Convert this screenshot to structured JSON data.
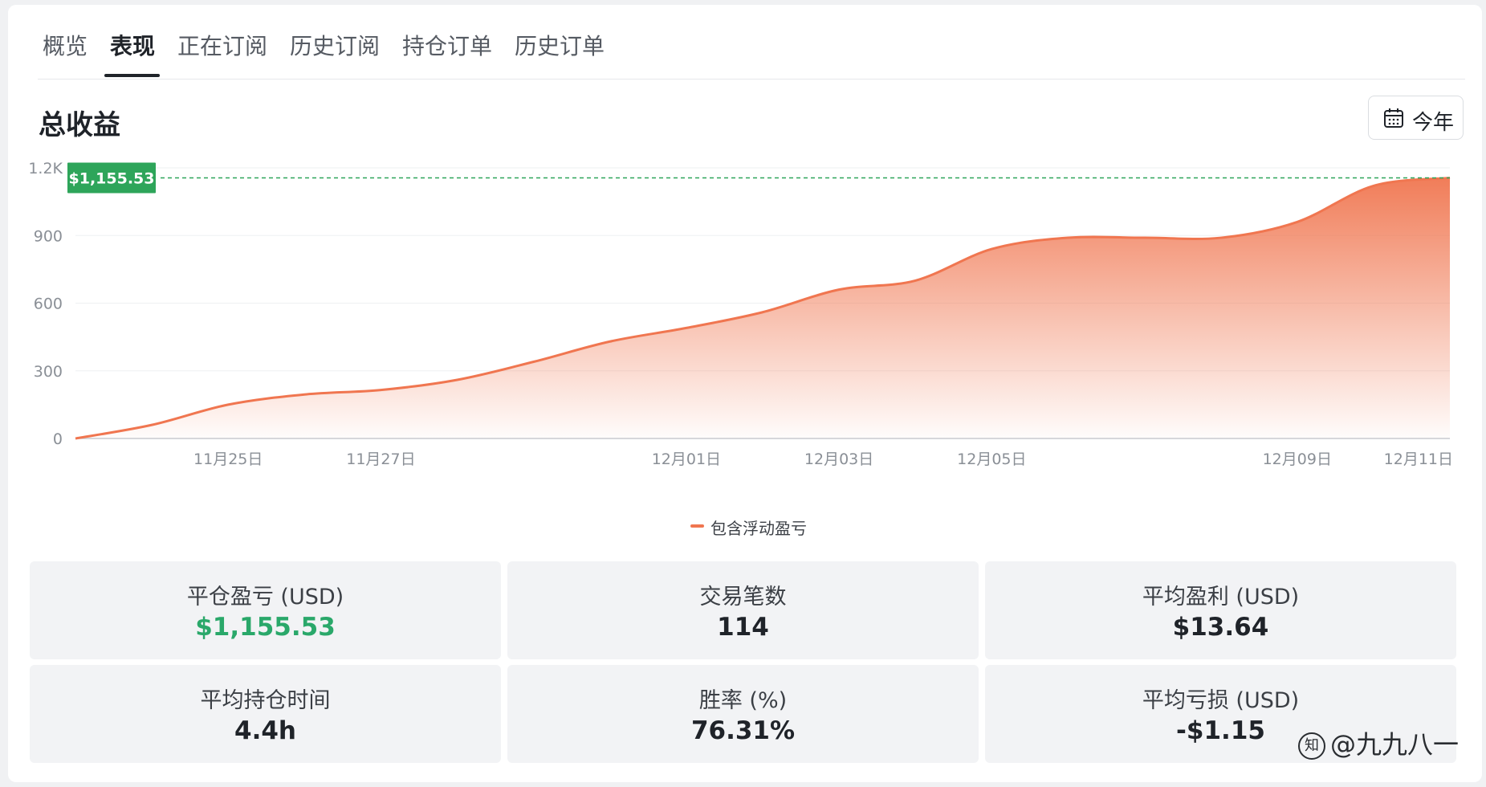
{
  "tabs": [
    {
      "label": "概览"
    },
    {
      "label": "表现"
    },
    {
      "label": "正在订阅"
    },
    {
      "label": "历史订阅"
    },
    {
      "label": "持仓订单"
    },
    {
      "label": "历史订单"
    }
  ],
  "active_tab": "表现",
  "section_title": "总收益",
  "period_button": {
    "label": "今年",
    "icon": "calendar-icon"
  },
  "chart_data": {
    "type": "area",
    "title": "",
    "xlabel": "",
    "ylabel": "",
    "ylim": [
      0,
      1200
    ],
    "yticks": [
      "0",
      "300",
      "600",
      "900",
      "1.2K"
    ],
    "ytick_values": [
      0,
      300,
      600,
      900,
      1200
    ],
    "x": [
      "11月23日",
      "11月24日",
      "11月25日",
      "11月26日",
      "11月27日",
      "11月28日",
      "11月29日",
      "11月30日",
      "12月01日",
      "12月02日",
      "12月03日",
      "12月04日",
      "12月05日",
      "12月06日",
      "12月07日",
      "12月08日",
      "12月09日",
      "12月10日",
      "12月11日"
    ],
    "xtick_labels": [
      "11月25日",
      "11月27日",
      "12月01日",
      "12月03日",
      "12月05日",
      "12月09日",
      "12月11日"
    ],
    "xtick_indices": [
      2,
      4,
      8,
      10,
      12,
      16,
      18
    ],
    "series": [
      {
        "name": "包含浮动盈亏",
        "color": "#f07650",
        "values": [
          0,
          60,
          150,
          195,
          215,
          260,
          340,
          430,
          490,
          560,
          660,
          700,
          840,
          890,
          890,
          890,
          960,
          1120,
          1155.53
        ]
      }
    ],
    "marker": {
      "label": "$1,155.53",
      "value": 1155.53,
      "color": "#2ea55a"
    },
    "legend": "bottom-center"
  },
  "stats": [
    {
      "label": "平仓盈亏 (USD)",
      "value": "$1,155.53",
      "highlight": "green"
    },
    {
      "label": "交易笔数",
      "value": "114"
    },
    {
      "label": "平均盈利 (USD)",
      "value": "$13.64"
    },
    {
      "label": "平均持仓时间",
      "value": "4.4h"
    },
    {
      "label": "胜率 (%)",
      "value": "76.31%"
    },
    {
      "label": "平均亏损 (USD)",
      "value": "-$1.15"
    }
  ],
  "watermark": "@九九八一",
  "colors": {
    "accent_line": "#f07650",
    "positive": "#2aa86a",
    "marker_green": "#2ea55a"
  }
}
